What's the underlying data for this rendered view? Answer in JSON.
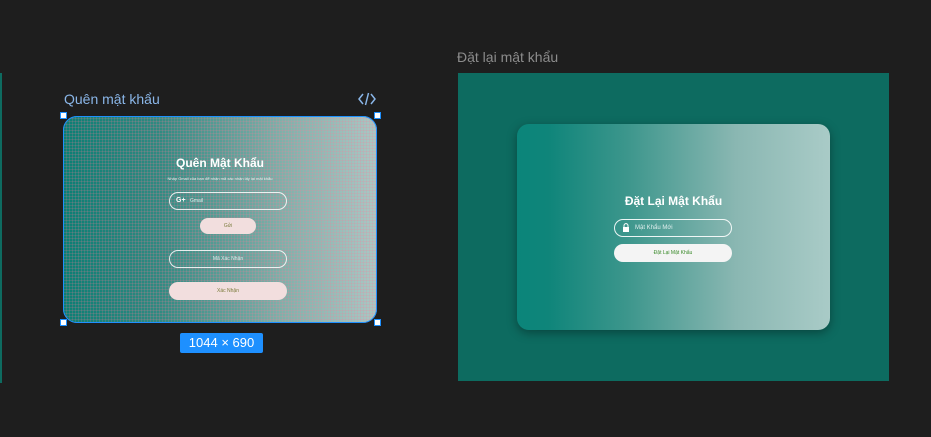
{
  "frames": [
    {
      "label": "Quên mật khẩu",
      "dimensions": "1044 × 690",
      "title": "Quên Mật Khẩu",
      "subtitle": "Nhập Gmail của bạn để nhận mã xác nhận lấy lại mật khẩu",
      "email_placeholder": "Gmail",
      "send_button": "Gửi",
      "code_placeholder": "Mã Xác Nhận",
      "confirm_button": "Xác Nhận"
    },
    {
      "label": "Đặt lại mật khẩu",
      "title": "Đặt Lại Mật Khẩu",
      "password_placeholder": "Mật Khẩu Mới",
      "reset_button": "Đặt Lại Mật Khẩu"
    }
  ],
  "icons": {
    "code": "code-icon",
    "google": "google-icon",
    "lock": "lock-icon"
  },
  "colors": {
    "canvas": "#1e1e1e",
    "selection": "#1e90ff",
    "teal": "#0d6b60"
  }
}
